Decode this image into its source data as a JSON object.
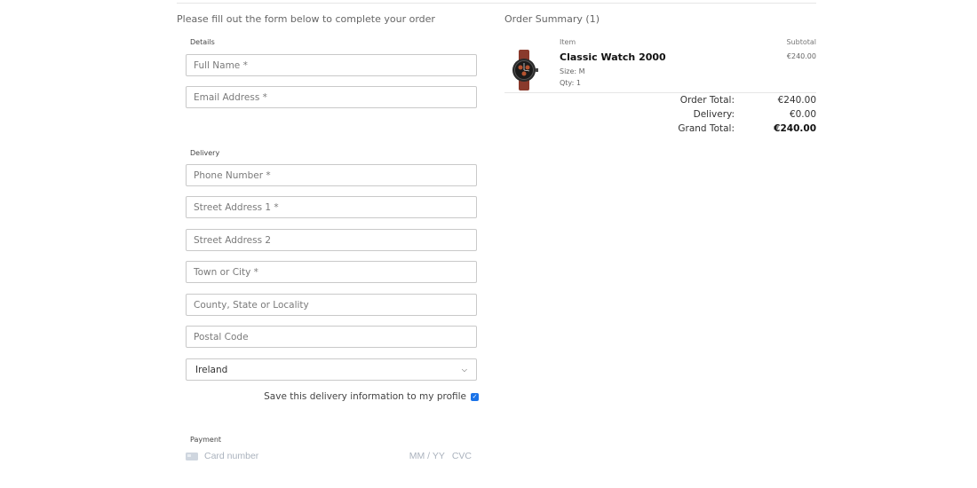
{
  "form": {
    "intro": "Please fill out the form below to complete your order",
    "details_legend": "Details",
    "full_name_placeholder": "Full Name *",
    "email_placeholder": "Email Address *",
    "delivery_legend": "Delivery",
    "phone_placeholder": "Phone Number *",
    "street1_placeholder": "Street Address 1 *",
    "street2_placeholder": "Street Address 2",
    "town_placeholder": "Town or City *",
    "county_placeholder": "County, State or Locality",
    "postcode_placeholder": "Postal Code",
    "country_selected": "Ireland",
    "save_info_label": "Save this delivery information to my profile",
    "save_info_checked": true,
    "payment_legend": "Payment",
    "card_number_placeholder": "Card number",
    "card_expiry_placeholder": "MM / YY",
    "card_cvc_placeholder": "CVC"
  },
  "summary": {
    "title": "Order Summary (1)",
    "item_header": "Item",
    "subtotal_header": "Subtotal",
    "item": {
      "name": "Classic Watch 2000",
      "size": "Size: M",
      "qty": "Qty: 1",
      "subtotal": "€240.00",
      "icon": "watch-thumbnail"
    },
    "order_total_label": "Order Total:",
    "order_total_value": "€240.00",
    "delivery_label": "Delivery:",
    "delivery_value": "€0.00",
    "grand_total_label": "Grand Total:",
    "grand_total_value": "€240.00"
  },
  "colors": {
    "accent": "#1a73e8",
    "border": "#c9c9c9"
  }
}
